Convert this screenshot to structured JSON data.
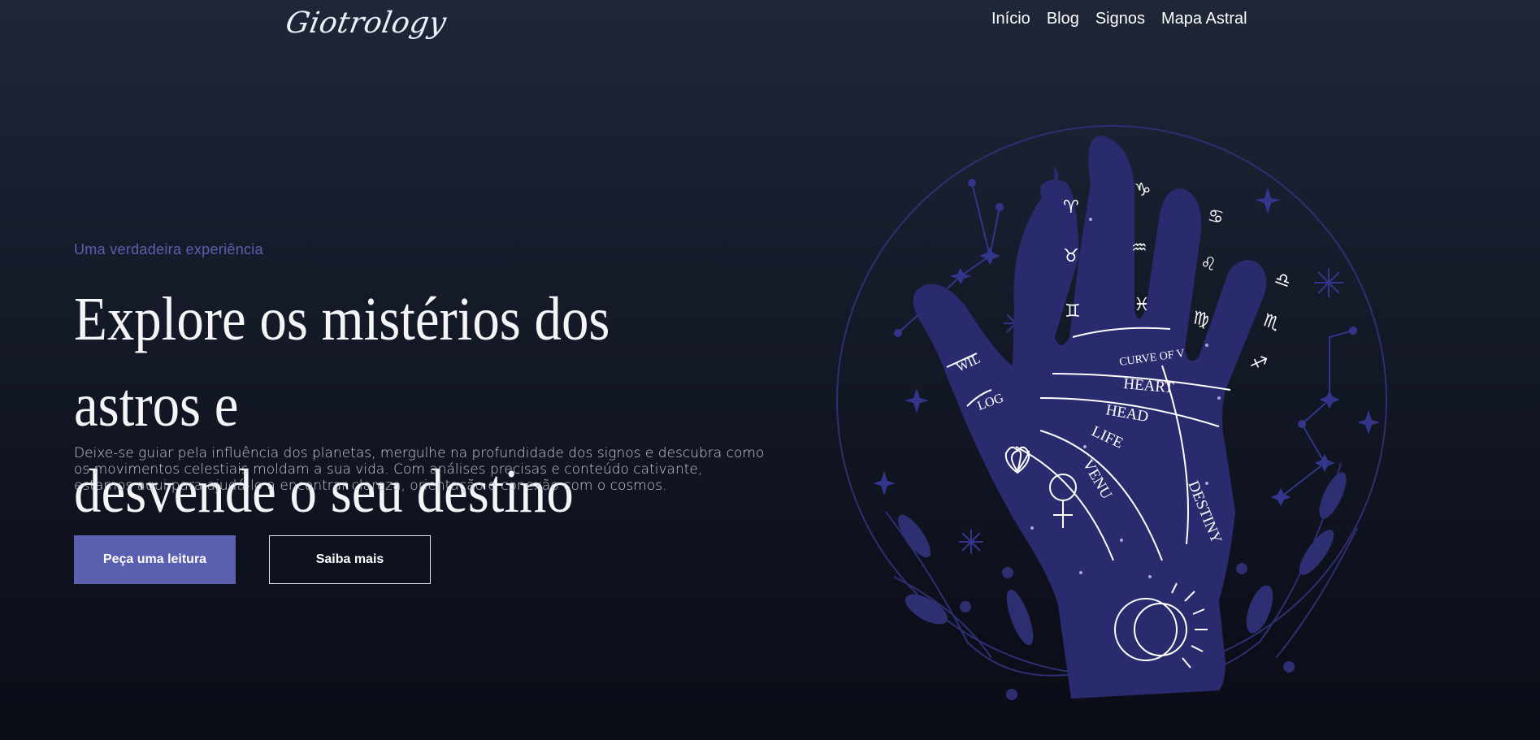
{
  "header": {
    "logo": "Giotrology",
    "nav": [
      "Início",
      "Blog",
      "Signos",
      "Mapa Astral"
    ]
  },
  "hero": {
    "eyebrow": "Uma verdadeira experiência",
    "title_line1": "Explore os mistérios dos astros e",
    "title_line2": "desvende o seu destino",
    "description": "Deixe-se guiar pela influência dos planetas, mergulhe na profundidade dos signos e descubra como os movimentos celestiais moldam a sua vida. Com análises precisas e conteúdo cativante, estamos aqui para ajudá-lo a encontrar clareza, orientação e conexão com o cosmos.",
    "primary_button": "Peça uma leitura",
    "secondary_button": "Saiba mais"
  },
  "illustration": {
    "palm_labels": [
      "WIL",
      "LOG",
      "CURVE OF V",
      "HEART",
      "HEAD",
      "LIFE",
      "VENU",
      "DESTINY"
    ],
    "zodiac_symbols": [
      "♈",
      "♉",
      "♊",
      "♑",
      "♒",
      "♓",
      "♋",
      "♌",
      "♍",
      "♎",
      "♏",
      "♐"
    ],
    "colors": {
      "hand": "#2a2a6e",
      "line": "#3b3b8a",
      "accent": "#5b5fb0"
    }
  }
}
